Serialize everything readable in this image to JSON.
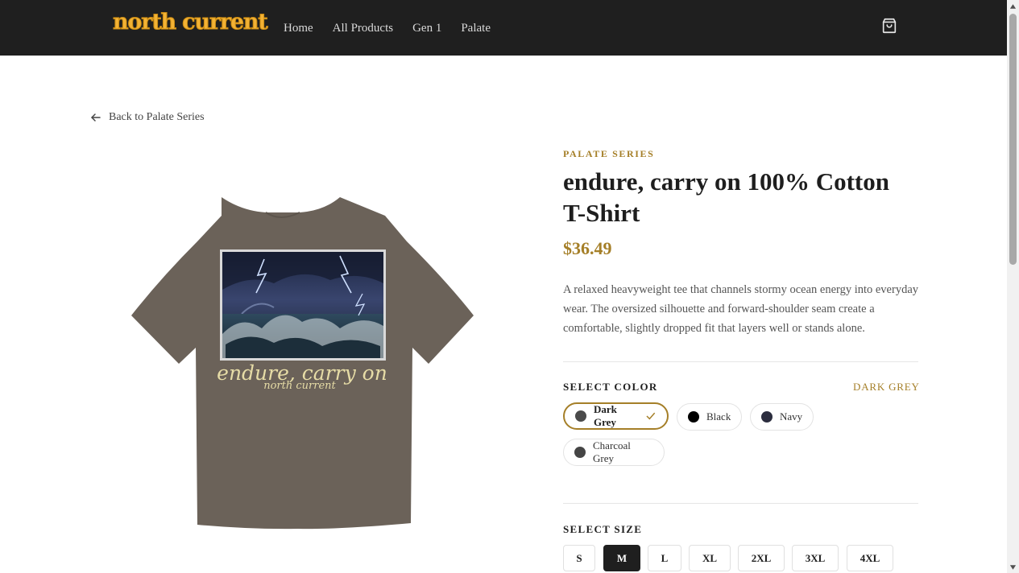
{
  "header": {
    "logo": "north current",
    "nav": [
      "Home",
      "All Products",
      "Gen 1",
      "Palate"
    ]
  },
  "breadcrumb": {
    "back_label": "Back to Palate Series"
  },
  "product": {
    "series": "PALATE SERIES",
    "title": "endure, carry on 100% Cotton T-Shirt",
    "price": "$36.49",
    "description": "A relaxed heavyweight tee that channels stormy ocean energy into everyday wear. The oversized silhouette and forward-shoulder seam create a comfortable, slightly dropped fit that layers well or stands alone.",
    "image_text": {
      "line1": "endure, carry on",
      "line2": "north current"
    }
  },
  "color": {
    "label": "SELECT COLOR",
    "selected": "DARK GREY",
    "options": [
      {
        "name": "Dark Grey",
        "hex": "#4a4a4a",
        "selected": true
      },
      {
        "name": "Black",
        "hex": "#000000",
        "selected": false
      },
      {
        "name": "Navy",
        "hex": "#2b2d3e",
        "selected": false
      },
      {
        "name": "Charcoal Grey",
        "hex": "#454545",
        "selected": false
      }
    ]
  },
  "size": {
    "label": "SELECT SIZE",
    "options": [
      "S",
      "M",
      "L",
      "XL",
      "2XL",
      "3XL",
      "4XL"
    ],
    "selected": "M"
  },
  "colors": {
    "accent": "#a57f28",
    "nav_bg": "#1f1f1f",
    "logo": "#f3b234",
    "shirt": "#6b6259"
  }
}
